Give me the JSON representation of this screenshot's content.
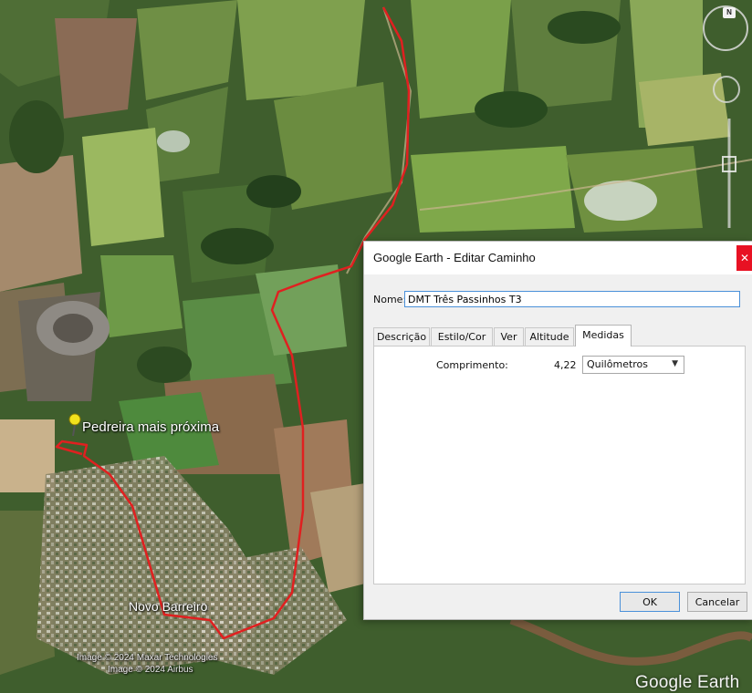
{
  "map": {
    "labels": {
      "quarry": "Pedreira mais próxima",
      "town": "Novo Barreiro"
    },
    "copyright": [
      "Image © 2024 Maxar Technologies",
      "Image © 2024 Airbus"
    ],
    "brand": "Google Earth",
    "compass_label": "N",
    "path_color": "#e02020"
  },
  "dialog": {
    "title": "Google Earth - Editar Caminho",
    "close_glyph": "✕",
    "name_label": "Nome:",
    "name_value": "DMT Três Passinhos T3",
    "tabs": [
      {
        "label": "Descrição",
        "active": false
      },
      {
        "label": "Estilo/Cor",
        "active": false
      },
      {
        "label": "Ver",
        "active": false
      },
      {
        "label": "Altitude",
        "active": false
      },
      {
        "label": "Medidas",
        "active": true
      }
    ],
    "measure": {
      "length_label": "Comprimento:",
      "length_value": "4,22",
      "unit_selected": "Quilômetros"
    },
    "ok_label": "OK",
    "cancel_label": "Cancelar"
  }
}
